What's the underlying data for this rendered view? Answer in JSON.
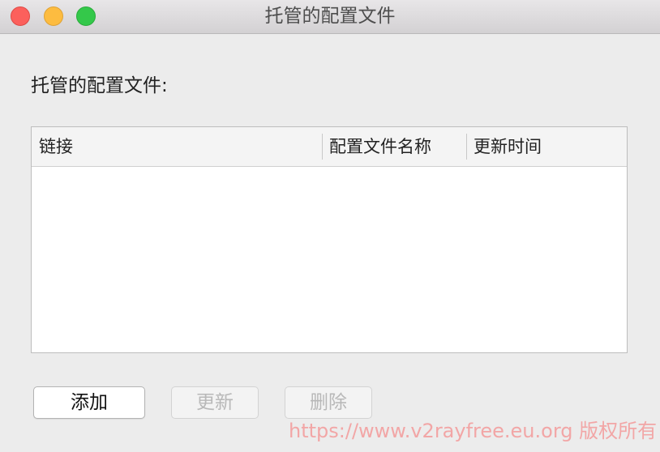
{
  "window": {
    "title": "托管的配置文件"
  },
  "section": {
    "label": "托管的配置文件:"
  },
  "table": {
    "columns": [
      "链接",
      "配置文件名称",
      "更新时间"
    ],
    "rows": []
  },
  "buttons": {
    "add_label": "添加",
    "update_label": "更新",
    "delete_label": "删除"
  },
  "watermark": {
    "text": "https://www.v2rayfree.eu.org 版权所有"
  },
  "colors": {
    "close": "#fc605c",
    "minimize": "#fdbc40",
    "zoom": "#34c84a",
    "watermark": "#f2a6a6"
  }
}
